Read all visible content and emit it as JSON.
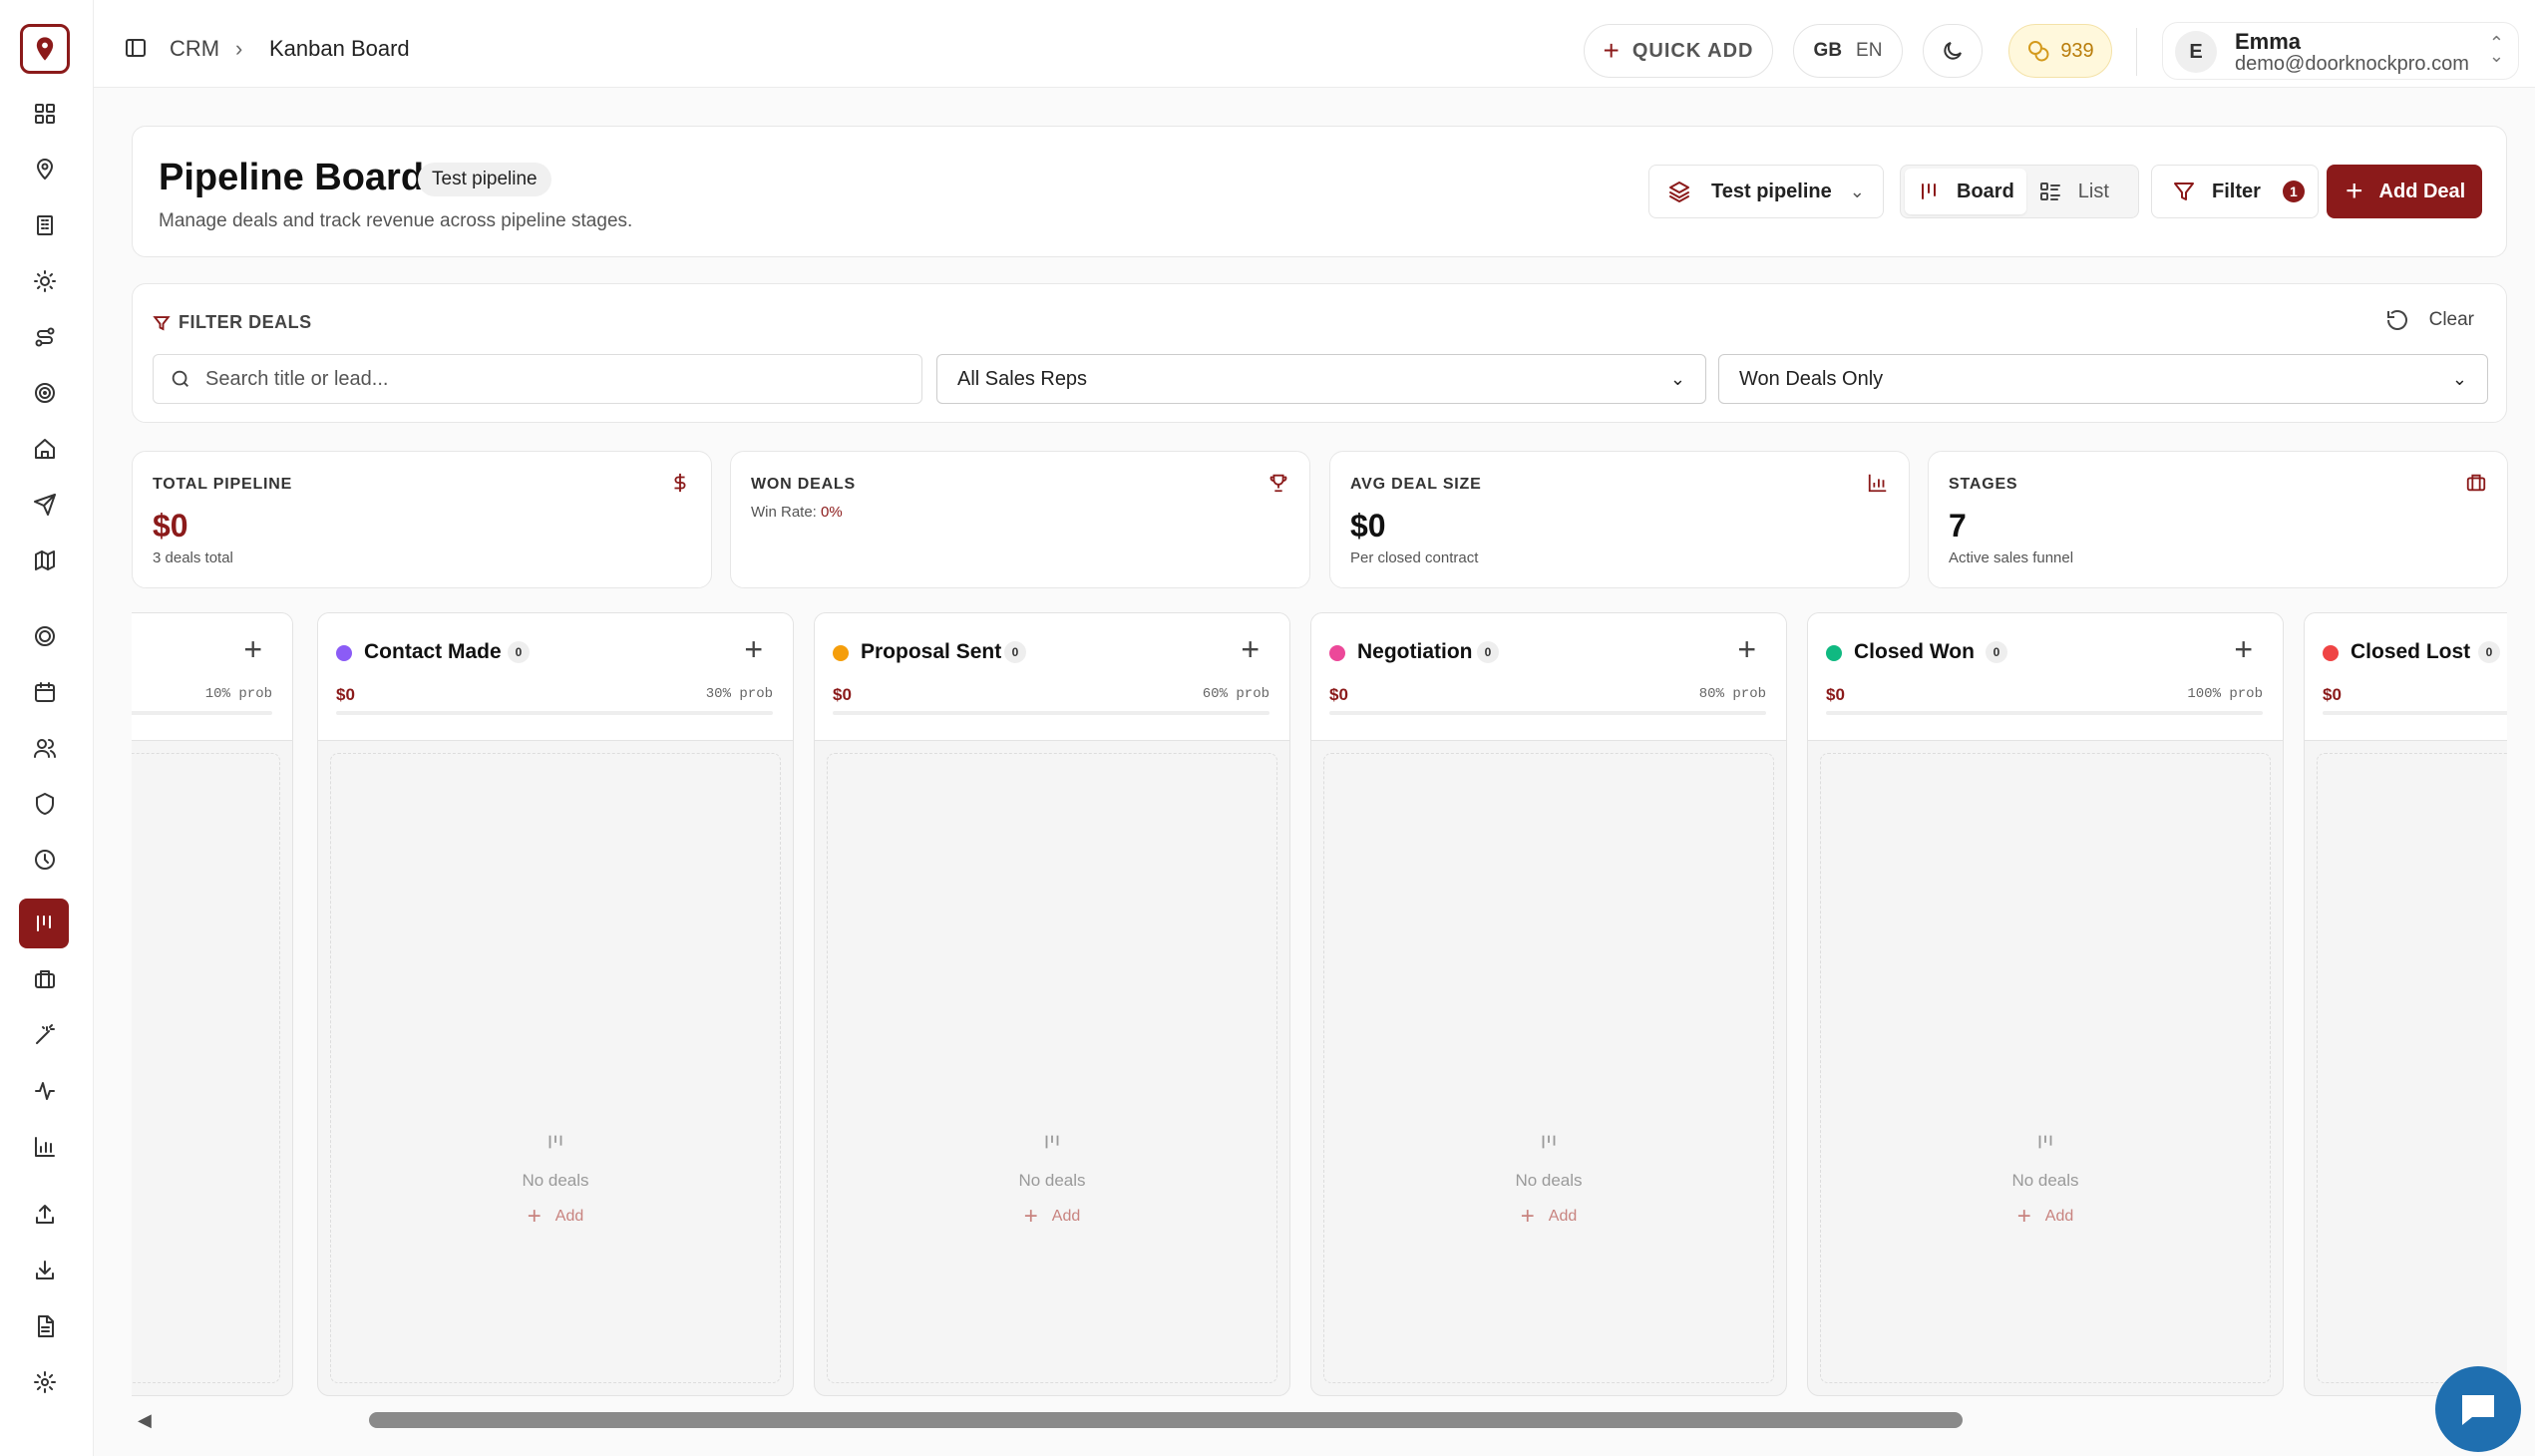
{
  "breadcrumb": {
    "root": "CRM",
    "current": "Kanban Board"
  },
  "topbar": {
    "quick_add": "QUICK ADD",
    "lang_flag": "GB",
    "lang_code": "EN",
    "credits": "939"
  },
  "user": {
    "initial": "E",
    "name": "Emma",
    "email": "demo@doorknockpro.com"
  },
  "header": {
    "title": "Pipeline Board",
    "badge": "Test pipeline",
    "subtitle": "Manage deals and track revenue across pipeline stages.",
    "pipeline_select": "Test pipeline",
    "view_board": "Board",
    "view_list": "List",
    "filter_label": "Filter",
    "filter_count": "1",
    "add_deal": "Add Deal"
  },
  "filters": {
    "title": "FILTER DEALS",
    "clear": "Clear",
    "search_placeholder": "Search title or lead...",
    "sales_rep": "All Sales Reps",
    "status": "Won Deals Only"
  },
  "stats": {
    "total": {
      "label": "TOTAL PIPELINE",
      "value": "$0",
      "sub": "3 deals total"
    },
    "won": {
      "label": "WON DEALS",
      "sub_prefix": "Win Rate: ",
      "sub_value": "0%"
    },
    "avg": {
      "label": "AVG DEAL SIZE",
      "value": "$0",
      "sub": "Per closed contract"
    },
    "stages": {
      "label": "STAGES",
      "value": "7",
      "sub": "Active sales funnel"
    }
  },
  "columns": [
    {
      "name": "",
      "count": "",
      "money": "",
      "prob": "10% prob",
      "color": ""
    },
    {
      "name": "Contact Made",
      "count": "0",
      "money": "$0",
      "prob": "30% prob",
      "color": "#8b5cf6"
    },
    {
      "name": "Proposal Sent",
      "count": "0",
      "money": "$0",
      "prob": "60% prob",
      "color": "#f59e0b"
    },
    {
      "name": "Negotiation",
      "count": "0",
      "money": "$0",
      "prob": "80% prob",
      "color": "#ec4899"
    },
    {
      "name": "Closed Won",
      "count": "0",
      "money": "$0",
      "prob": "100% prob",
      "color": "#10b981"
    },
    {
      "name": "Closed Lost",
      "count": "0",
      "money": "$0",
      "prob": "",
      "color": "#ef4444"
    }
  ],
  "empty": {
    "text": "No deals",
    "add": "Add"
  },
  "sidebar_icons": [
    "dashboard-icon",
    "map-pin-icon",
    "building-icon",
    "sun-icon",
    "route-icon",
    "target-icon",
    "home-icon",
    "send-icon",
    "map-icon",
    "crosshair-icon",
    "calendar-icon",
    "users-icon",
    "shield-icon",
    "clock-icon",
    "kanban-icon",
    "briefcase-icon",
    "magic-wand-icon",
    "activity-icon",
    "bar-chart-icon",
    "upload-icon",
    "download-icon",
    "file-text-icon",
    "settings-icon"
  ],
  "colors": {
    "accent": "#8b1a1a",
    "chat": "#1f6fb0"
  }
}
